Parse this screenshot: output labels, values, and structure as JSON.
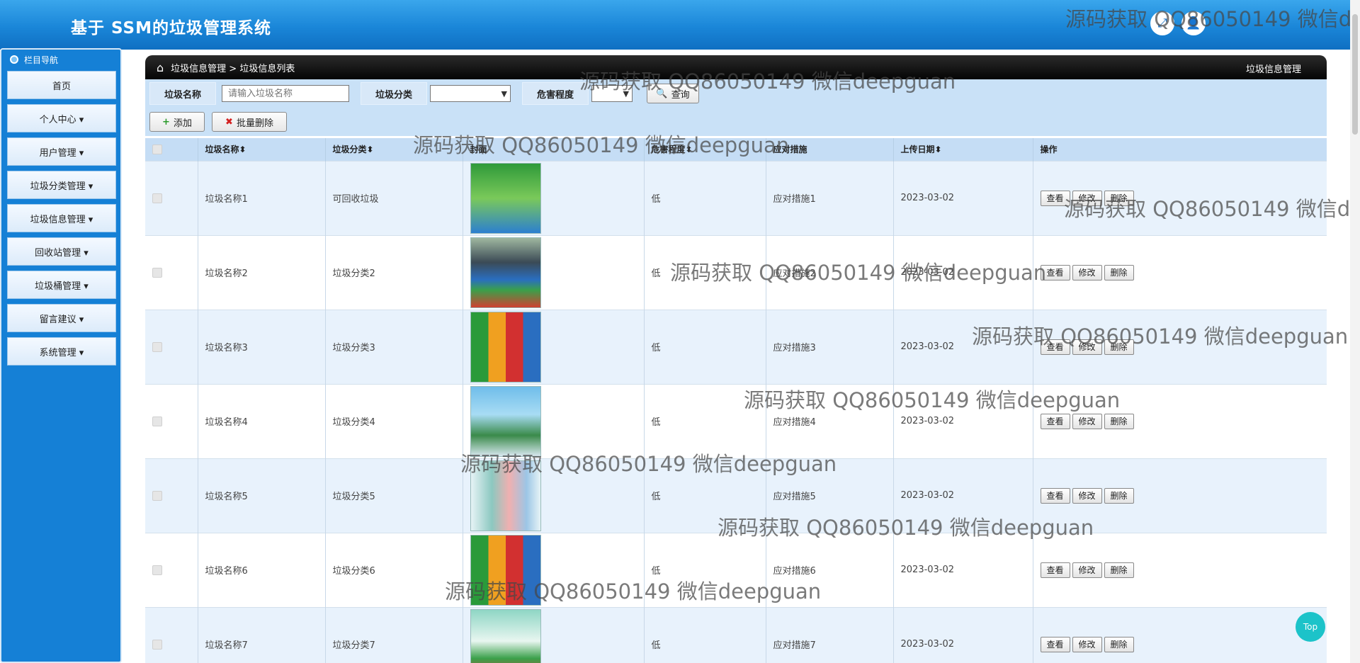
{
  "app": {
    "title": "基于 SSM的垃圾管理系统"
  },
  "header_icons": [
    "expand-icon",
    "user-icon"
  ],
  "sidebar": {
    "heading": "栏目导航",
    "items": [
      {
        "label": "首页"
      },
      {
        "label": "个人中心 ▾"
      },
      {
        "label": "用户管理 ▾"
      },
      {
        "label": "垃圾分类管理 ▾"
      },
      {
        "label": "垃圾信息管理 ▾"
      },
      {
        "label": "回收站管理 ▾"
      },
      {
        "label": "垃圾桶管理 ▾"
      },
      {
        "label": "留言建议 ▾"
      },
      {
        "label": "系统管理 ▾"
      }
    ]
  },
  "breadcrumb": {
    "path": "垃圾信息管理 > 垃圾信息列表",
    "right": "垃圾信息管理"
  },
  "search": {
    "name_label": "垃圾名称",
    "name_placeholder": "请输入垃圾名称",
    "category_label": "垃圾分类",
    "hazard_label": "危害程度",
    "query_button": "查询"
  },
  "toolbar": {
    "add_button": "添加",
    "batch_delete_button": "批量删除"
  },
  "table": {
    "columns": [
      "垃圾名称⬍",
      "垃圾分类⬍",
      "封面",
      "危害程度⬍",
      "应对措施",
      "上传日期⬍",
      "操作"
    ],
    "rows": [
      {
        "name": "垃圾名称1",
        "category": "可回收垃圾",
        "hazard": "低",
        "measure": "应对措施1",
        "date": "2023-03-02"
      },
      {
        "name": "垃圾名称2",
        "category": "垃圾分类2",
        "hazard": "低",
        "measure": "应对措施2",
        "date": "2023-03-02"
      },
      {
        "name": "垃圾名称3",
        "category": "垃圾分类3",
        "hazard": "低",
        "measure": "应对措施3",
        "date": "2023-03-02"
      },
      {
        "name": "垃圾名称4",
        "category": "垃圾分类4",
        "hazard": "低",
        "measure": "应对措施4",
        "date": "2023-03-02"
      },
      {
        "name": "垃圾名称5",
        "category": "垃圾分类5",
        "hazard": "低",
        "measure": "应对措施5",
        "date": "2023-03-02"
      },
      {
        "name": "垃圾名称6",
        "category": "垃圾分类6",
        "hazard": "低",
        "measure": "应对措施6",
        "date": "2023-03-02"
      },
      {
        "name": "垃圾名称7",
        "category": "垃圾分类7",
        "hazard": "低",
        "measure": "应对措施7",
        "date": "2023-03-02"
      }
    ],
    "row_actions": {
      "view": "查看",
      "edit": "修改",
      "delete": "删除"
    }
  },
  "watermark": "源码获取 QQ86050149 微信deepguan",
  "top_button": "Top"
}
